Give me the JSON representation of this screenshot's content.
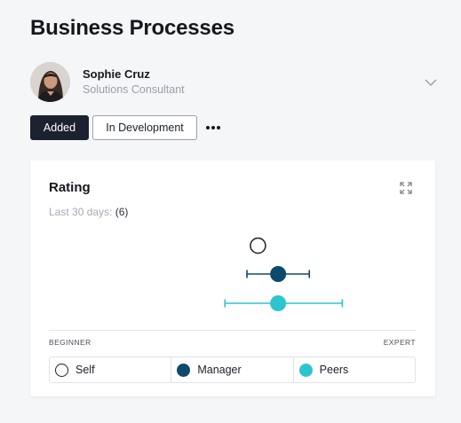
{
  "page": {
    "title": "Business Processes"
  },
  "user": {
    "name": "Sophie Cruz",
    "role": "Solutions Consultant"
  },
  "actions": {
    "added_label": "Added",
    "in_development_label": "In Development"
  },
  "card": {
    "title": "Rating",
    "period_label": "Last 30 days:",
    "period_count": "(6)"
  },
  "colors": {
    "manager": "#0d4a6b",
    "peers": "#2ec4cf",
    "self_stroke": "#1b1f2a",
    "dark_button": "#1c2130"
  },
  "chart_data": {
    "type": "scatter",
    "x_axis": {
      "min_label": "BEGINNER",
      "max_label": "EXPERT"
    },
    "series": [
      {
        "name": "Self",
        "value": 0.57
      },
      {
        "name": "Manager",
        "value": 0.625,
        "range": [
          0.54,
          0.71
        ]
      },
      {
        "name": "Peers",
        "value": 0.625,
        "range": [
          0.48,
          0.8
        ]
      }
    ]
  },
  "legend": [
    {
      "label": "Self"
    },
    {
      "label": "Manager"
    },
    {
      "label": "Peers"
    }
  ]
}
